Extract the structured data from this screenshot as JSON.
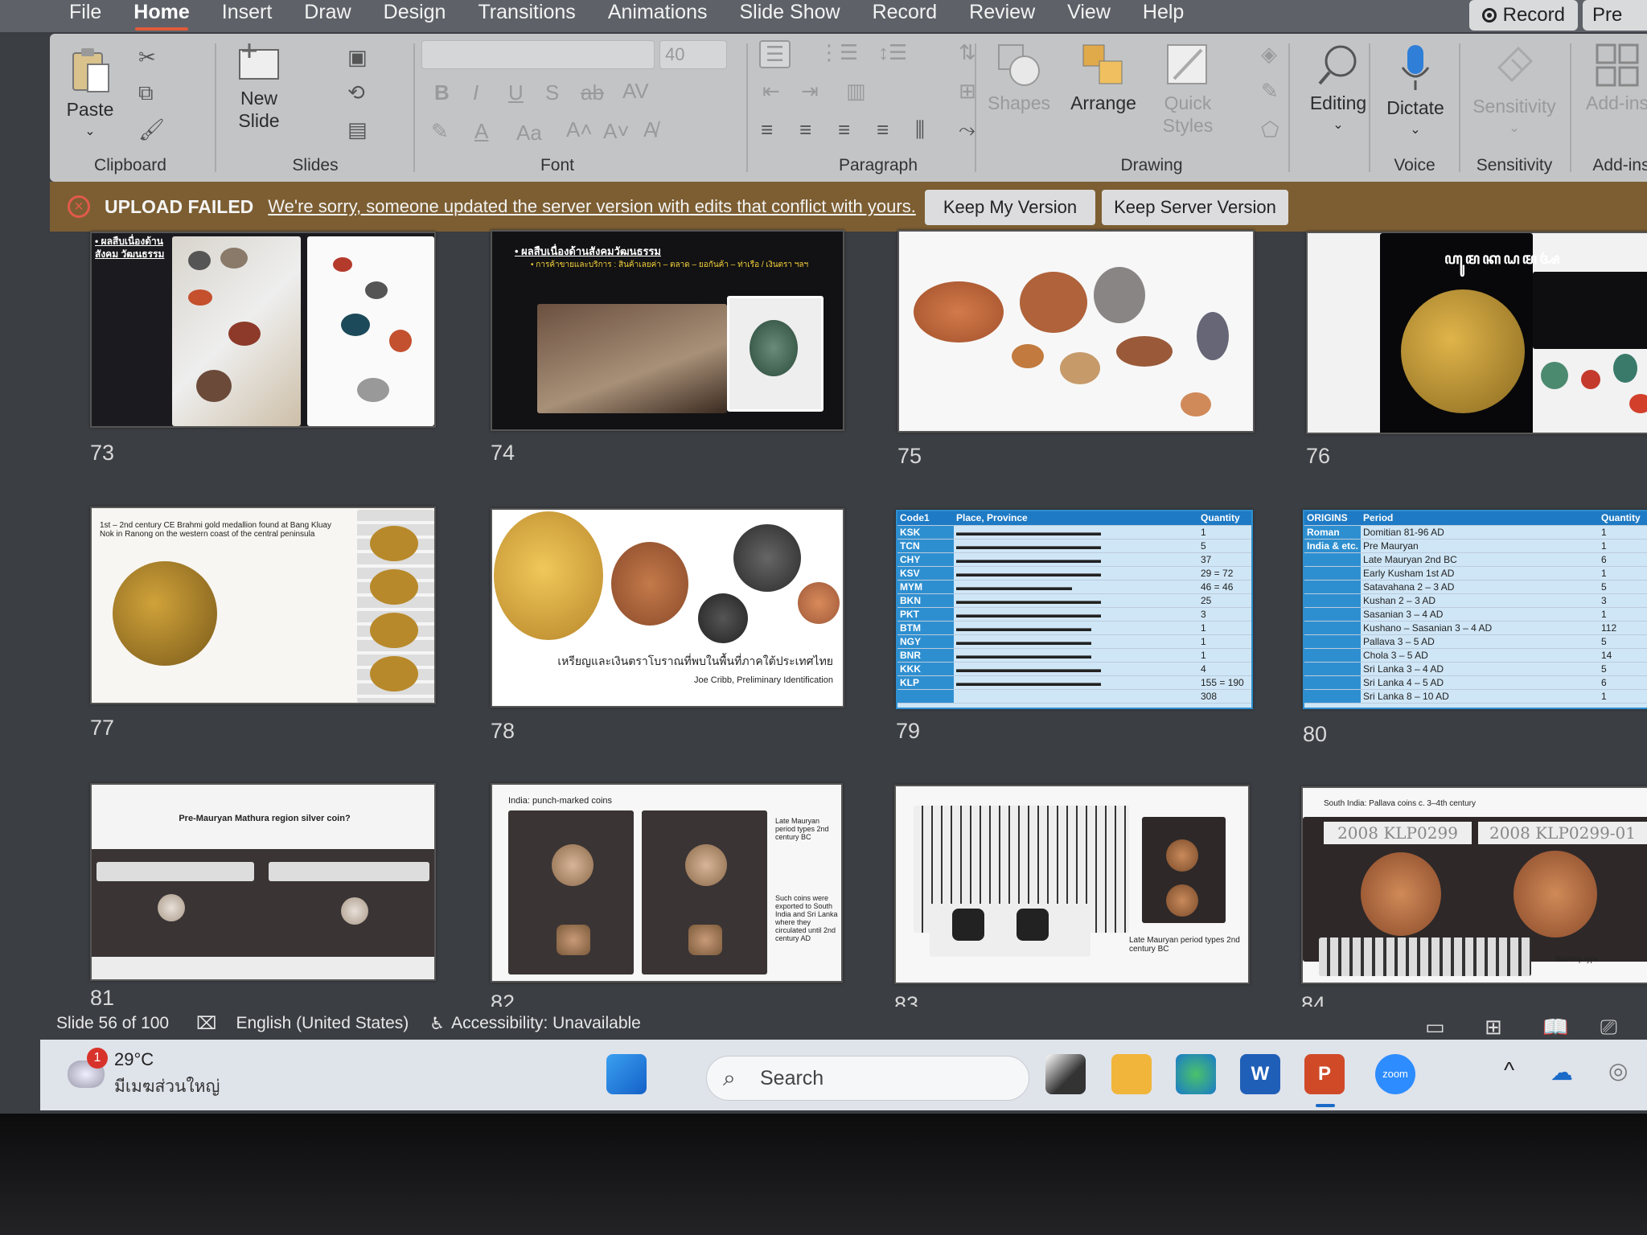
{
  "tabs": [
    "File",
    "Home",
    "Insert",
    "Draw",
    "Design",
    "Transitions",
    "Animations",
    "Slide Show",
    "Record",
    "Review",
    "View",
    "Help"
  ],
  "record_label": "Record",
  "present_label": "Pre",
  "ribbon": {
    "paste": "Paste",
    "new_slide_1": "New",
    "new_slide_2": "Slide",
    "font_size": "40",
    "shapes": "Shapes",
    "arrange": "Arrange",
    "quick_1": "Quick",
    "quick_2": "Styles",
    "editing": "Editing",
    "dictate": "Dictate",
    "sensitivity": "Sensitivity",
    "addins": "Add-ins",
    "groups": {
      "clipboard": "Clipboard",
      "slides": "Slides",
      "font": "Font",
      "paragraph": "Paragraph",
      "drawing": "Drawing",
      "voice": "Voice",
      "sensitivity": "Sensitivity",
      "addins": "Add-ins"
    }
  },
  "banner": {
    "title": "UPLOAD FAILED",
    "message": "We're sorry, someone updated the server version with edits that conflict with yours.",
    "keep_mine": "Keep My Version",
    "keep_server": "Keep Server Version"
  },
  "slides": {
    "n73": "73",
    "n74": "74",
    "n75": "75",
    "n76": "76",
    "n77": "77",
    "n78": "78",
    "n79": "79",
    "n80": "80",
    "n81": "81",
    "n82": "82",
    "n83": "83",
    "n84": "84",
    "s73_title": "• ผลสืบเนื่องด้าน สังคม วัฒนธรรม",
    "s74_title": "• ผลสืบเนื่องด้านสังคมวัฒนธรรม",
    "s74_sub": "• การค้าขายและบริการ : สินค้าเลยค่า – ตลาด – ยอกันค้า – ท่าเรือ / เงินตรา ฯลฯ",
    "s76_title": "ꦲꦸꦩꦏꦝꦩꦄ",
    "s77_caption": "1st – 2nd century CE Brahmi gold medallion found at Bang Kluay Nok in Ranong on the western coast of the central peninsula",
    "s78_caption": "เหรียญและเงินตราโบราณที่พบในพื้นที่ภาคใต้ประเทศไทย",
    "s78_author": "Joe Cribb, Preliminary Identification",
    "s81_title": "Pre-Mauryan Mathura region silver coin?",
    "s82_title": "India: punch-marked coins",
    "s82_note1": "Late Mauryan period types 2nd century BC",
    "s82_note2": "Such coins were exported to South India and Sri Lanka where they circulated until 2nd century AD",
    "s83_note": "Late Mauryan period types 2nd century BC",
    "s84_title": "South India: Pallava coins c. 3–4th century",
    "s84_label1": "2008 KLP0299",
    "s84_label2": "2008 KLP0299-01",
    "s84_note": "Bull/ship type"
  },
  "table79": {
    "headers": [
      "Code1",
      "Place, Province",
      "Quantity"
    ],
    "rows": [
      [
        "KSK",
        "",
        "1"
      ],
      [
        "TCN",
        "",
        "5"
      ],
      [
        "CHY",
        "",
        "37"
      ],
      [
        "KSV",
        "",
        "29 = 72"
      ],
      [
        "MYM",
        "",
        "46 = 46"
      ],
      [
        "BKN",
        "",
        "25"
      ],
      [
        "PKT",
        "",
        "3"
      ],
      [
        "BTM",
        "",
        "1"
      ],
      [
        "NGY",
        "",
        "1"
      ],
      [
        "BNR",
        "",
        "1"
      ],
      [
        "KKK",
        "",
        "4"
      ],
      [
        "KLP",
        "",
        "155 = 190"
      ],
      [
        "",
        "",
        "308"
      ]
    ]
  },
  "table80": {
    "headers": [
      "ORIGINS",
      "Period",
      "Quantity"
    ],
    "rows": [
      [
        "Roman",
        "Domitian 81-96 AD",
        "1"
      ],
      [
        "India & etc.",
        "Pre Mauryan",
        "1"
      ],
      [
        "",
        "Late Mauryan 2nd BC",
        "6"
      ],
      [
        "",
        "Early Kusham 1st AD",
        "1"
      ],
      [
        "",
        "Satavahana 2 – 3 AD",
        "5"
      ],
      [
        "",
        "Kushan 2 – 3 AD",
        "3"
      ],
      [
        "",
        "Sasanian 3 – 4 AD",
        "1"
      ],
      [
        "",
        "Kushano – Sasanian 3 – 4 AD",
        "112"
      ],
      [
        "",
        "Pallava 3 – 5 AD",
        "5"
      ],
      [
        "",
        "Chola 3 – 5 AD",
        "14"
      ],
      [
        "",
        "Sri Lanka 3 – 4 AD",
        "5"
      ],
      [
        "",
        "Sri Lanka 4 – 5 AD",
        "6"
      ],
      [
        "",
        "Sri Lanka 8 – 10 AD",
        "1"
      ]
    ]
  },
  "status": {
    "slide_count": "Slide 56 of 100",
    "language": "English (United States)",
    "accessibility": "Accessibility: Unavailable"
  },
  "taskbar": {
    "temp": "29°C",
    "weather": "มีเมฆส่วนใหญ่",
    "notif": "1",
    "search": "Search"
  }
}
